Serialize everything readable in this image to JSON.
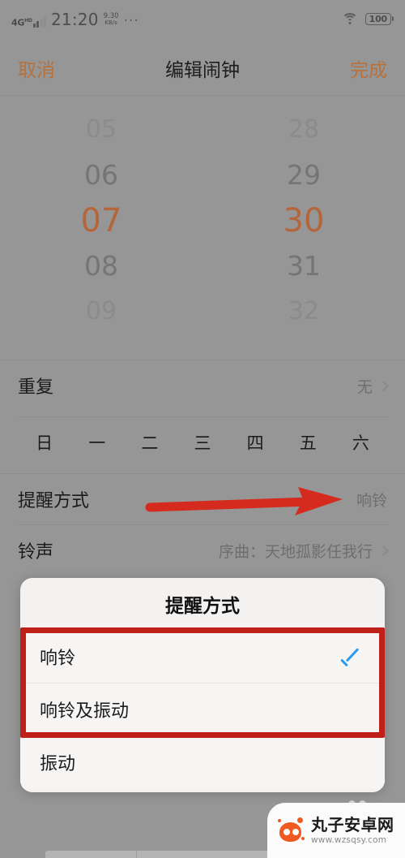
{
  "status_bar": {
    "network_type": "4G",
    "network_sup": "HD",
    "time": "21:20",
    "net_speed_value": "9.30",
    "net_speed_unit": "KB/s",
    "overflow": "···",
    "battery_level": "100"
  },
  "nav": {
    "cancel_label": "取消",
    "title": "编辑闹钟",
    "done_label": "完成",
    "accent_color": "#b5713e"
  },
  "time_picker": {
    "hours": [
      "05",
      "06",
      "07",
      "08",
      "09"
    ],
    "minutes": [
      "28",
      "29",
      "30",
      "31",
      "32"
    ],
    "selected_hour": "07",
    "selected_minute": "30",
    "selected_color": "#b4653a"
  },
  "rows": {
    "repeat": {
      "label": "重复",
      "value": "无"
    },
    "weekdays": [
      "日",
      "一",
      "二",
      "三",
      "四",
      "五",
      "六"
    ],
    "reminder": {
      "label": "提醒方式",
      "value": "响铃"
    },
    "ringtone": {
      "label": "铃声",
      "value": "序曲：天地孤影任我行"
    }
  },
  "dialog": {
    "title": "提醒方式",
    "options": [
      {
        "label": "响铃",
        "checked": true
      },
      {
        "label": "响铃及振动",
        "checked": false
      },
      {
        "label": "振动",
        "checked": false
      }
    ],
    "check_color": "#2b9bf0"
  },
  "annotation": {
    "arrow_color": "#d52b1e",
    "highlight_color": "#bf2017"
  },
  "watermark": {
    "name": "丸子安卓网",
    "url": "www.wzsqsy.com"
  }
}
